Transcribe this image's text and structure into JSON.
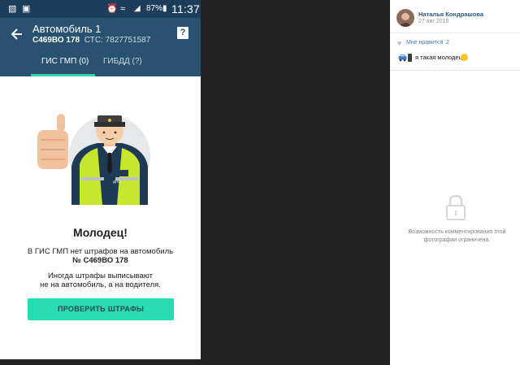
{
  "status_bar": {
    "battery": "87%",
    "time": "11:37",
    "icons": [
      "shield-icon",
      "photo-icon",
      "alarm-icon",
      "wifi-icon",
      "signal-icon",
      "battery-icon"
    ]
  },
  "app_bar": {
    "title": "Автомобиль 1",
    "plate": "С469ВО 178",
    "sts": "СТС: 7827751587",
    "help_label": "?"
  },
  "tabs": [
    {
      "label": "ГИС ГМП (0)",
      "active": true
    },
    {
      "label": "ГИБДД (?)",
      "active": false
    }
  ],
  "result": {
    "title": "Молодец!",
    "line1": "В ГИС ГМП нет штрафов на автомобиль",
    "line2": "№ С469ВО 178",
    "line3": "Иногда штрафы выписывают",
    "line4": "не на автомобиль, а на водителя.",
    "button": "ПРОВЕРИТЬ ШТРАФЫ",
    "badge": "ДПС"
  },
  "social": {
    "author": "Наталья Кондрашова",
    "date": "27 авг 2016",
    "likes_label": "Мне нравится",
    "likes_count": "2",
    "caption": "я такая молодец",
    "comments_note": "Возможность комментирования этой фотографии ограничена."
  },
  "colors": {
    "status_bar": "#1c3e5a",
    "app_bar": "#28526f",
    "accent": "#27dcb1",
    "background": "#222222",
    "link": "#2a5885"
  }
}
